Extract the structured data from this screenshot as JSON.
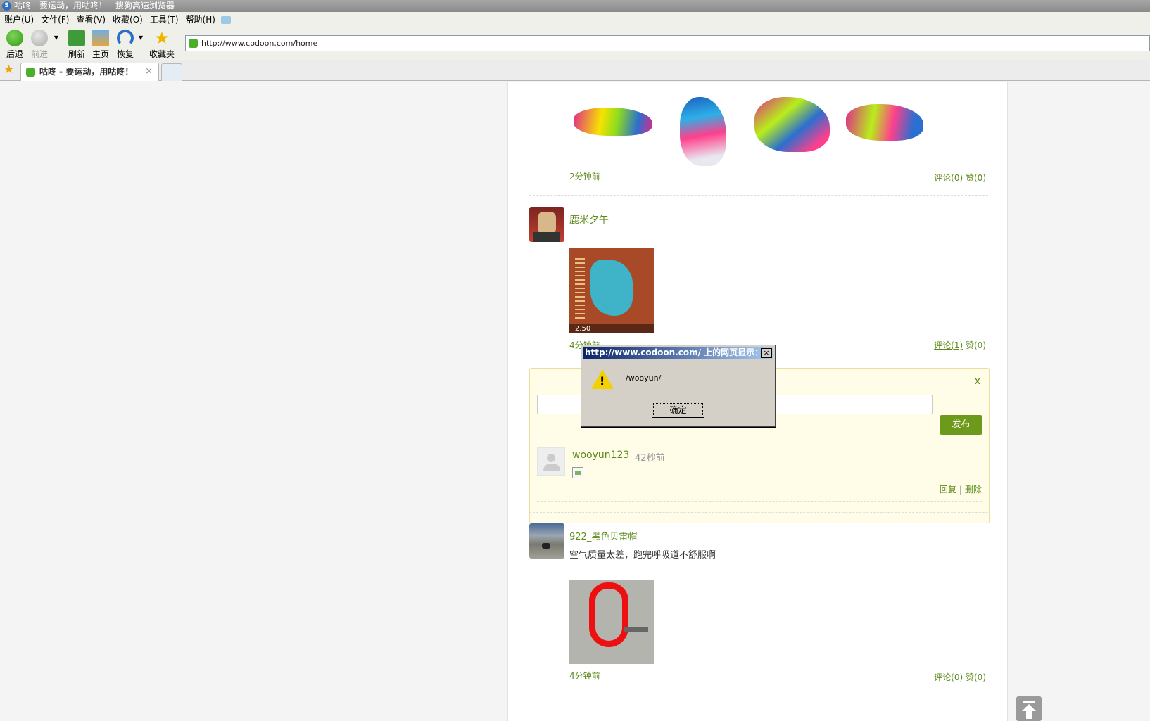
{
  "window": {
    "title": "咕咚 - 要运动，用咕咚！ - 搜狗高速浏览器"
  },
  "menu": {
    "items": [
      "账户(U)",
      "文件(F)",
      "查看(V)",
      "收藏(O)",
      "工具(T)",
      "帮助(H)"
    ]
  },
  "toolbar": {
    "back": "后退",
    "forward": "前进",
    "refresh": "刷新",
    "home": "主页",
    "restore": "恢复",
    "favorites": "收藏夹"
  },
  "address": {
    "url": "http://www.codoon.com/home"
  },
  "tabs": [
    {
      "label": "咕咚 - 要运动，用咕咚！",
      "close": "×"
    }
  ],
  "feed": {
    "post1": {
      "time": "2分钟前",
      "comment": "评论(0)",
      "like": "赞(0)"
    },
    "post2": {
      "user": "鹿米夕午",
      "time": "4分钟前",
      "comment": "评论(1)",
      "like": "赞(0)",
      "map_label": "2.50"
    },
    "comment_box": {
      "close": "x",
      "publish": "发布",
      "reply_user": "wooyun123",
      "reply_time": "42秒前",
      "reply": "回复",
      "delete": "删除",
      "separator": "|"
    },
    "post3": {
      "user": "922_黑色贝雷帽",
      "text": "空气质量太差，跑完呼吸道不舒服啊",
      "time": "4分钟前",
      "comment": "评论(0)",
      "like": "赞(0)"
    }
  },
  "dialog": {
    "title": "http://www.codoon.com/ 上的网页显示：",
    "message": "/wooyun/",
    "ok": "确定",
    "close": "×"
  },
  "colors": {
    "accent_green": "#5d8a1a",
    "publish_button": "#6e9a1b",
    "comment_bg": "#fffde8"
  }
}
